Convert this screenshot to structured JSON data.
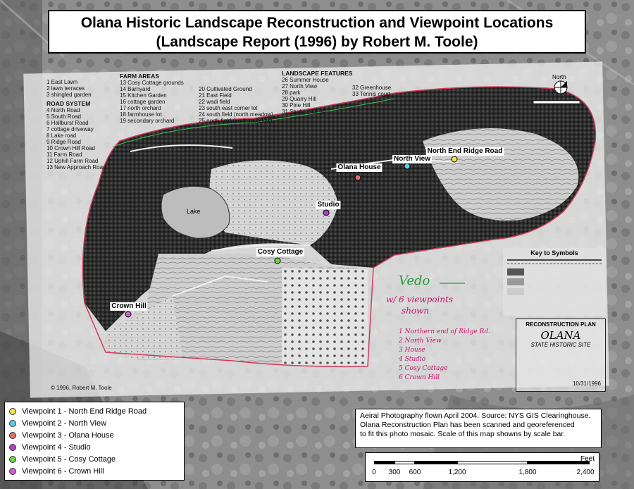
{
  "title": {
    "line1": "Olana Historic Landscape Reconstruction and Viewpoint Locations",
    "line2": "(Landscape Report (1996) by Robert M. Toole)"
  },
  "viewpoints": [
    {
      "label": "Viewpoint 1 - North End Ridge Road",
      "map_label": "North End Ridge Road",
      "color": "#f2e24b"
    },
    {
      "label": "Viewpoint 2 - North View",
      "map_label": "North View",
      "color": "#5bd0e8"
    },
    {
      "label": "Viewpoint 3 - Olana House",
      "map_label": "Olana House",
      "color": "#e07070"
    },
    {
      "label": "Viewpoint 4 - Studio",
      "map_label": "Studio",
      "color": "#b140c8"
    },
    {
      "label": "Viewpoint 5 - Cosy Cottage",
      "map_label": "Cosy Cottage",
      "color": "#70d24a"
    },
    {
      "label": "Viewpoint 6 - Crown Hill",
      "map_label": "Crown Hill",
      "color": "#d060d0"
    }
  ],
  "source": {
    "line1": "Aeiral Photography flown April 2004.  Source: NYS GIS Clearinghouse.",
    "line2": "Olana Reconstruction Plan has been scanned and georeferenced",
    "line3": "to fit this photo mosaic.  Scale of this map showns by scale bar."
  },
  "scale": {
    "unit": "Feet",
    "ticks": [
      "0",
      "300",
      "600",
      "1,200",
      "1,800",
      "2,400"
    ]
  },
  "plan": {
    "list_main": [
      "1  East Lawn",
      "2  lawn terraces",
      "3  shingled garden"
    ],
    "road_head": "ROAD SYSTEM",
    "roads": [
      "4  North Road",
      "5  South Road",
      "6  Hallburst Road",
      "7  cottage driveway",
      "8  Lake road",
      "9  Ridge Road",
      "10  Crown Hill Road",
      "11  Farm Road",
      "12  Uphill Farm Road",
      "13  New Approach Road"
    ],
    "farm_head": "FARM AREAS",
    "farm": [
      "13  Cosy Cottage grounds",
      "14  Barnyard",
      "15  Kitchen Garden",
      "16  cottage garden",
      "17  north orchard",
      "18  farmhouse lot",
      "19  secondary orchard"
    ],
    "farm2": [
      "20  Cultivated Ground",
      "21  East Field",
      "22  wadi field",
      "23  south east corner lot",
      "24  south field (north meadow)",
      "25  north field (north meadow)"
    ],
    "features_head": "LANDSCAPE FEATURES",
    "features": [
      "26  Summer House",
      "27  North View",
      "28  park",
      "29  Quarry Hill",
      "30  Pine Hill",
      "31  Studio (site of)"
    ],
    "features2": [
      "32  Greenhouse",
      "33  Tennis court"
    ],
    "lake": "Lake",
    "north": "North",
    "key_title": "Key to Symbols",
    "plan_head": "RECONSTRUCTION PLAN",
    "plan_name": "OLANA",
    "plan_sub": "STATE HISTORIC SITE",
    "copyright": "© 1996, Robert M. Toole",
    "date": "10/31/1996"
  },
  "handwriting": {
    "word": "Vedo",
    "line1": "w/ 6 viewpoints",
    "line2": "shown",
    "items": [
      "1  Northern end of Ridge Rd.",
      "2  North View",
      "3  House",
      "4  Studio",
      "5  Cosy Cottage",
      "6  Crown Hill"
    ]
  }
}
